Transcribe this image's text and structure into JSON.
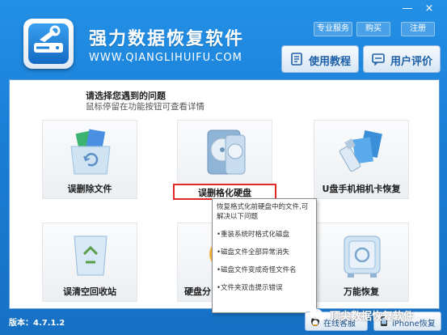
{
  "header": {
    "app_title": "强力数据恢复软件",
    "url": "WWW.QIANGLIHUIFU.COM",
    "top_links": [
      "专业服务",
      "购买",
      "注册"
    ],
    "window_controls": [
      "minimize-icon",
      "close-icon"
    ],
    "window_glyphs": [
      "—",
      "×"
    ],
    "guide_button": "使用教程",
    "review_button": "用户评价"
  },
  "main": {
    "heading": "请选择您遇到的问题",
    "subheading": "鼠标停留在功能按钮可查看详情",
    "tiles": [
      {
        "label": "误删除文件",
        "icon": "folder-recycle-icon"
      },
      {
        "label": "误删格化硬盘",
        "icon": "hard-drive-icon",
        "selected": true
      },
      {
        "label": "U盘手机相机卡恢复",
        "icon": "usb-sdcard-icon"
      },
      {
        "label": "误清空回收站",
        "icon": "recycle-bin-icon"
      },
      {
        "label": "硬盘分",
        "icon": "disk-partition-icon"
      },
      {
        "label": "万能恢复",
        "icon": "safe-icon"
      }
    ]
  },
  "tooltip": {
    "intro": "恢复格式化前硬盘中的文件,可解决以下问题",
    "items": [
      "•重装系统时格式化磁盘",
      "•磁盘文件全部异常消失",
      "•磁盘文件变成奇怪文件名",
      "•文件夹双击提示错误"
    ]
  },
  "footer": {
    "version": "版本：4.7.1.2",
    "online_service": "在线客服",
    "iphone_recovery": "iPhone恢复",
    "watermark": "顶尖数据恢复软件"
  },
  "colors": {
    "header_blue": "#1a7fd6",
    "highlight_red": "#e02a2a",
    "button_text": "#1d5fa6"
  }
}
